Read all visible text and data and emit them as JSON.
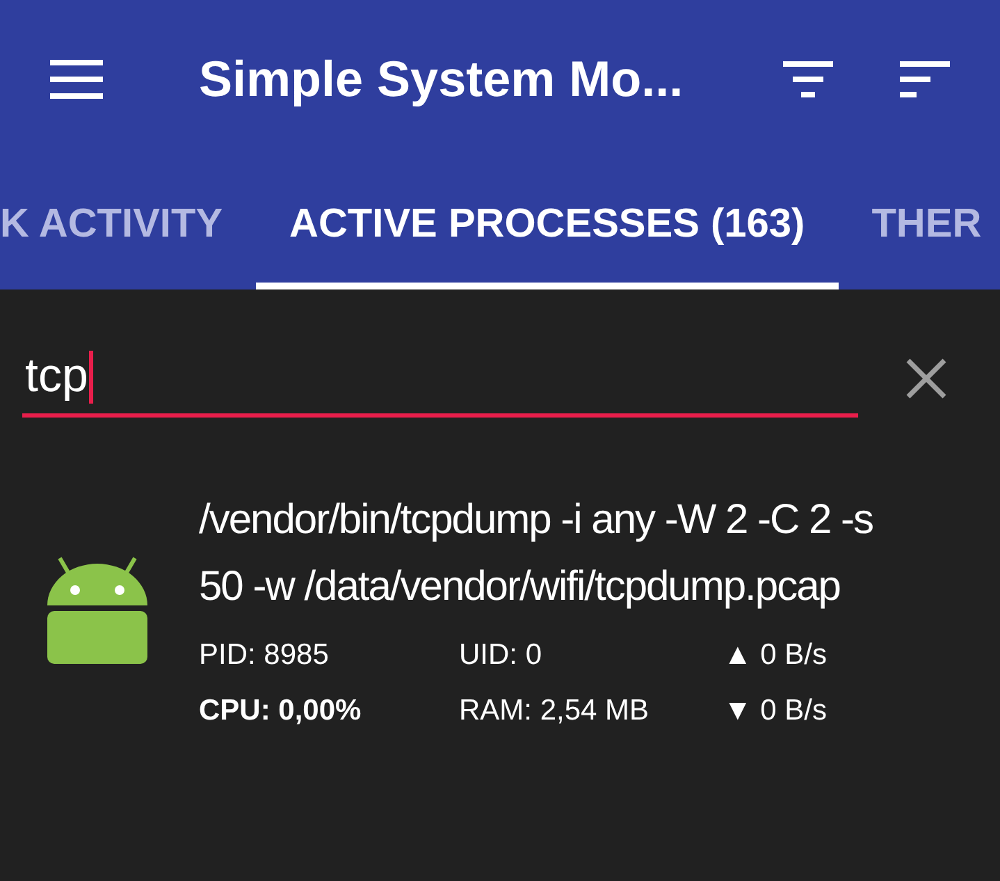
{
  "app_bar": {
    "title": "Simple System Mo..."
  },
  "tabs": [
    {
      "label": "K ACTIVITY",
      "selected": false
    },
    {
      "label": "ACTIVE PROCESSES (163)",
      "selected": true
    },
    {
      "label": "THER",
      "selected": false
    }
  ],
  "search": {
    "value": "tcp"
  },
  "processes": [
    {
      "command": "/vendor/bin/tcpdump -i any -W 2 -C 2 -s 50 -w /data/vendor/wifi/tcpdump.pcap",
      "stats": [
        {
          "text": "PID: 8985",
          "emphasized": false
        },
        {
          "text": "UID: 0",
          "emphasized": false
        },
        {
          "text": "▲ 0 B/s",
          "emphasized": false
        },
        {
          "text": "CPU: 0,00%",
          "emphasized": true
        },
        {
          "text": "RAM: 2,54 MB",
          "emphasized": false
        },
        {
          "text": "▼ 0 B/s",
          "emphasized": false
        }
      ]
    }
  ]
}
